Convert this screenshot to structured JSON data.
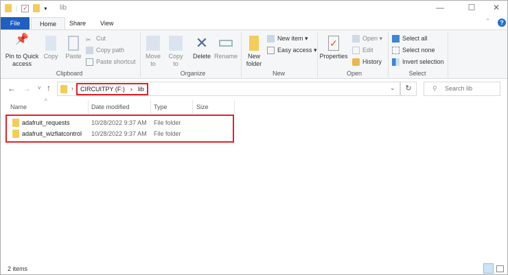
{
  "window": {
    "title": "lib",
    "minimize": "—",
    "maximize": "☐",
    "close": "✕",
    "help": "?"
  },
  "tabs": [
    {
      "label": "File"
    },
    {
      "label": "Home"
    },
    {
      "label": "Share"
    },
    {
      "label": "View"
    }
  ],
  "ribbon": {
    "clipboard": {
      "label": "Clipboard",
      "pin": "Pin to Quick access",
      "copy": "Copy",
      "paste": "Paste",
      "cut": "Cut",
      "copy_path": "Copy path",
      "paste_shortcut": "Paste shortcut"
    },
    "organize": {
      "label": "Organize",
      "move_to": "Move to",
      "copy_to": "Copy to",
      "delete": "Delete",
      "rename": "Rename"
    },
    "new": {
      "label": "New",
      "new_folder": "New folder",
      "new_item": "New item ▾",
      "easy_access": "Easy access ▾"
    },
    "open": {
      "label": "Open",
      "properties": "Properties",
      "open": "Open ▾",
      "edit": "Edit",
      "history": "History"
    },
    "select": {
      "label": "Select",
      "select_all": "Select all",
      "select_none": "Select none",
      "invert": "Invert selection"
    }
  },
  "address": {
    "crumbs": [
      "CIRCUITPY (F:)",
      "lib"
    ],
    "sep": "›",
    "search_placeholder": "Search lib"
  },
  "columns": [
    "Name",
    "Date modified",
    "Type",
    "Size"
  ],
  "files": [
    {
      "name": "adafruit_requests",
      "date": "10/28/2022 9:37 AM",
      "type": "File folder",
      "size": ""
    },
    {
      "name": "adafruit_wizfiatcontrol",
      "date": "10/28/2022 9:37 AM",
      "type": "File folder",
      "size": ""
    }
  ],
  "status": {
    "count": "2 items"
  }
}
